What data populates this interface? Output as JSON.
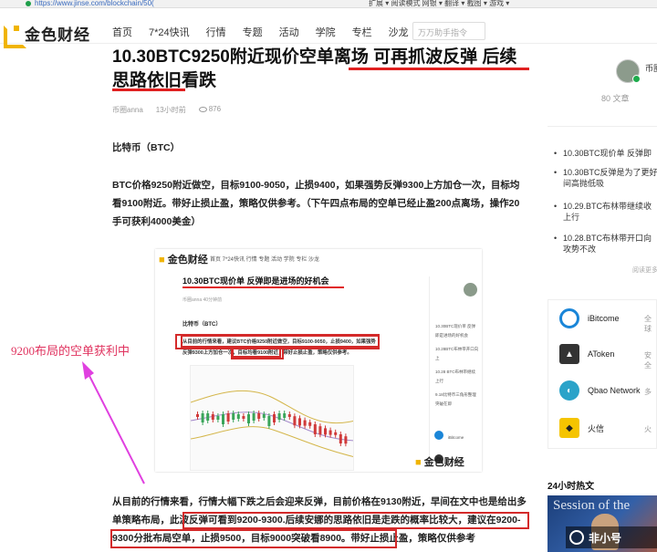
{
  "browser": {
    "url": "https://www.jinse.com/blockchain/50(",
    "extensions": "扩展 ▾  阅读模式  网银 ▾  翻译 ▾  截图 ▾  游戏 ▾"
  },
  "nav": {
    "logo": "金色财经",
    "links": [
      "首页",
      "7*24快讯",
      "行情",
      "专题",
      "活动",
      "学院",
      "专栏",
      "沙龙"
    ],
    "search_placeholder": "万万助手指令"
  },
  "article": {
    "title": "10.30BTC9250附近现价空单离场 可再抓波反弹 后续思路依旧看跌",
    "author": "币圈anna",
    "time": "13小时前",
    "views": "876",
    "section": "比特币（BTC）",
    "para1": "BTC价格9250附近做空，目标9100-9050，止损9400，如果强势反弹9300上方加仓一次，目标均看9100附近。带好止损止盈，策略仅供参考。（下午四点布局的空单已经止盈200点离场，操作20手可获利4000美金）",
    "para2": "从目前的行情来看，行情大幅下跌之后会迎来反弹，目前价格在9130附近，早间在文中也是给出多单策略布局，此波反弹可看到9200-9300.后续安娜的思路依旧是走跌的概率比较大，建议在9200-9300分批布局空单，止损9500，目标9000突破看8900。带好止损止盈，策略仅供参考"
  },
  "screenshot": {
    "logo": "金色财经",
    "nav": "首页    7*24快讯    行情    专题    活动    学院    专栏    沙龙",
    "title": "10.30BTC现价单 反弹即是进场的好机会",
    "meta": "币圈anna    40分钟前",
    "section": "比特币（BTC）",
    "text": "从目前的行情来看，建议BTC价格9250附近做空，目标9100-9050，止损9400，如果强势反弹9300上方加仓一次，目标均看9100附近，带好止损止盈，策略仅供参考。",
    "side_items": [
      "10.30BTC现价单 反弹即是进场的好机会",
      "10.28BTC布林带开口向上",
      "10.28 BTC布林带继续上行",
      "9.18比特币三角形整理突破在即"
    ],
    "exchanges": [
      "iBitcome",
      "AToken",
      "Qbao Network",
      "火信"
    ],
    "watermark": "金色财经"
  },
  "annotation": "9200布局的空单获利中",
  "sidebar": {
    "author": "币圈anna",
    "articles": "80 文章",
    "recent": [
      [
        "10.30BTC现价单 反弹即"
      ],
      [
        "10.30BTC反弹是为了更好",
        "间高抛低吸"
      ],
      [
        "10.29.BTC布林带继续收",
        "上行"
      ],
      [
        "10.28.BTC布林带开口向",
        "攻势不改"
      ]
    ],
    "read_more": "阅读更多",
    "exchanges": [
      {
        "name": "iBitcome",
        "link": "全球"
      },
      {
        "name": "AToken",
        "link": "安全"
      },
      {
        "name": "Qbao Network",
        "link": "多"
      },
      {
        "name": "火信",
        "link": "火"
      }
    ],
    "hot_title": "24小时热文",
    "hot_image_text": "Session of the",
    "watermark_text": "非小号"
  },
  "colors": {
    "accent": "#f0b400",
    "underline": "#e02020",
    "annotation": "#e0335f"
  }
}
